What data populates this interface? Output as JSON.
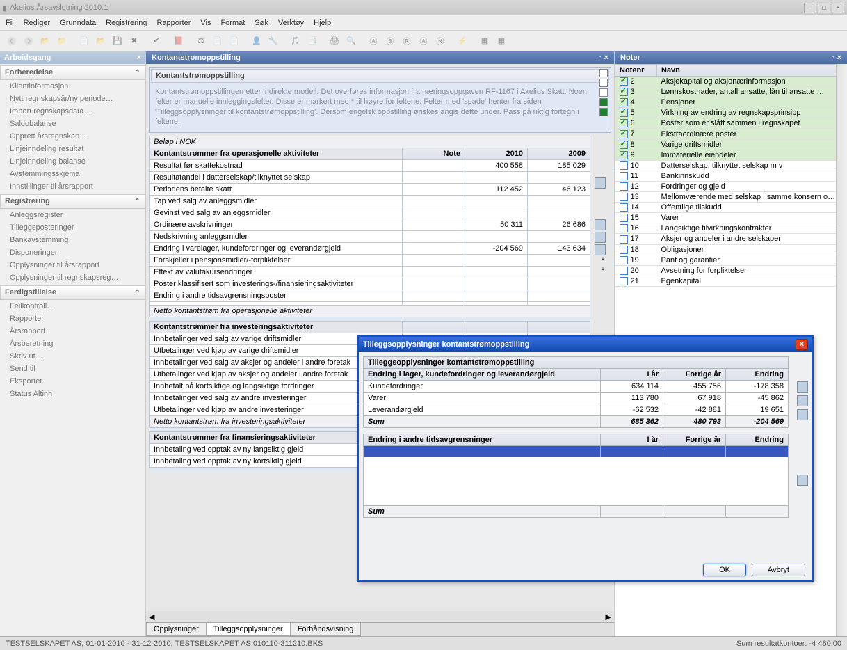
{
  "window": {
    "title": "Akelius Årsavslutning 2010.1"
  },
  "menu": [
    "Fil",
    "Rediger",
    "Grunndata",
    "Registrering",
    "Rapporter",
    "Vis",
    "Format",
    "Søk",
    "Verktøy",
    "Hjelp"
  ],
  "sidebar": {
    "title": "Arbeidsgang",
    "sections": [
      {
        "title": "Forberedelse",
        "items": [
          "Klientinformasjon",
          "Nytt regnskapsår/ny periode…",
          "Import regnskapsdata…",
          "Saldobalanse",
          "Opprett årsregnskap…",
          "Linjeinndeling resultat",
          "Linjeinndeling balanse",
          "Avstemmingsskjema",
          "Innstillinger til årsrapport"
        ]
      },
      {
        "title": "Registrering",
        "items": [
          "Anleggsregister",
          "Tilleggsposteringer",
          "Bankavstemming",
          "Disponeringer",
          "Opplysninger til årsrapport",
          "Opplysninger til regnskapsreg…"
        ]
      },
      {
        "title": "Ferdigstillelse",
        "items": [
          "Feilkontroll…",
          "Rapporter",
          "Årsrapport",
          "Årsberetning",
          "Skriv ut…",
          "Send til",
          "Eksporter",
          "Status Altinn"
        ]
      }
    ]
  },
  "center": {
    "title": "Kontantstrømoppstilling",
    "box_title": "Kontantstrømoppstilling",
    "desc": "Kontantstrømoppstillingen etter indirekte modell. Det overføres informasjon fra næringsoppgaven RF-1167 i Akelius Skatt. Noen felter er manuelle innleggingsfelter.  Disse er markert med * til høyre for feltene. Felter med 'spade' henter fra siden 'Tilleggsopplysninger til kontantstrømoppstilling'. Dersom engelsk oppstilling ønskes angis dette under. Pass på riktig fortegn i feltene.",
    "currency": "Beløp i NOK",
    "headers": {
      "note": "Note",
      "y1": "2010",
      "y2": "2009"
    },
    "sections": [
      {
        "title": "Kontantstrømmer fra operasjonelle aktiviteter",
        "rows": [
          {
            "l": "Resultat før skattekostnad",
            "a": "400 558",
            "b": "185 029"
          },
          {
            "l": "Resultatandel i datterselskap/tilknyttet selskap",
            "a": "",
            "b": ""
          },
          {
            "l": "Periodens betalte skatt",
            "a": "112 452",
            "b": "46 123"
          },
          {
            "l": "Tap ved salg av anleggsmidler",
            "a": "",
            "b": ""
          },
          {
            "l": "Gevinst ved salg av anleggsmidler",
            "a": "",
            "b": ""
          },
          {
            "l": "Ordinære avskrivninger",
            "a": "50 311",
            "b": "26 686"
          },
          {
            "l": "Nedskrivning anleggsmidler",
            "a": "",
            "b": ""
          },
          {
            "l": "Endring i varelager, kundefordringer og leverandørgjeld",
            "a": "-204 569",
            "b": "143 634"
          },
          {
            "l": "Forskjeller i pensjonsmidler/-forpliktelser",
            "a": "",
            "b": ""
          },
          {
            "l": "Effekt av valutakursendringer",
            "a": "",
            "b": ""
          },
          {
            "l": "Poster klassifisert som investerings-/finansieringsaktiviteter",
            "a": "",
            "b": ""
          },
          {
            "l": "Endring i andre tidsavgrensningsposter",
            "a": "",
            "b": ""
          },
          {
            "l": "",
            "a": "",
            "b": ""
          }
        ],
        "sum": "Netto kontantstrøm fra operasjonelle aktiviteter"
      },
      {
        "title": "Kontantstrømmer fra investeringsaktiviteter",
        "rows": [
          {
            "l": "Innbetalinger ved salg av varige driftsmidler",
            "a": "",
            "b": ""
          },
          {
            "l": "Utbetalinger ved kjøp av varige driftsmidler",
            "a": "",
            "b": ""
          },
          {
            "l": "Innbetalinger ved salg av aksjer og andeler i andre foretak",
            "a": "",
            "b": ""
          },
          {
            "l": "Utbetalinger ved kjøp av aksjer og andeler i andre foretak",
            "a": "",
            "b": ""
          },
          {
            "l": "Innbetalt på kortsiktige og langsiktige fordringer",
            "a": "",
            "b": ""
          },
          {
            "l": "Innbetalinger ved salg av andre investeringer",
            "a": "",
            "b": ""
          },
          {
            "l": "Utbetalinger ved kjøp av andre investeringer",
            "a": "",
            "b": ""
          }
        ],
        "sum": "Netto kontantstrøm fra investeringsaktiviteter"
      },
      {
        "title": "Kontantstrømmer fra finansieringsaktiviteter",
        "rows": [
          {
            "l": "Innbetaling ved opptak av ny langsiktig gjeld",
            "a": "",
            "b": ""
          },
          {
            "l": "Innbetaling ved opptak av ny kortsiktig gjeld",
            "a": "",
            "b": ""
          }
        ],
        "sum": ""
      }
    ],
    "tabs": [
      "Opplysninger",
      "Tilleggsopplysninger",
      "Forhåndsvisning"
    ],
    "active_tab": 1
  },
  "noter": {
    "title": "Noter",
    "headers": {
      "nr": "Notenr",
      "navn": "Navn"
    },
    "rows": [
      {
        "nr": "2",
        "navn": "Aksjekapital og aksjonærinformasjon",
        "on": true
      },
      {
        "nr": "3",
        "navn": "Lønnskostnader, antall ansatte, lån til ansatte …",
        "on": true
      },
      {
        "nr": "4",
        "navn": "Pensjoner",
        "on": true
      },
      {
        "nr": "5",
        "navn": "Virkning av endring av regnskapsprinsipp",
        "on": true
      },
      {
        "nr": "6",
        "navn": "Poster som er slått sammen i regnskapet",
        "on": true
      },
      {
        "nr": "7",
        "navn": "Ekstraordinære poster",
        "on": true
      },
      {
        "nr": "8",
        "navn": "Varige driftsmidler",
        "on": true
      },
      {
        "nr": "9",
        "navn": "Immaterielle eiendeler",
        "on": true
      },
      {
        "nr": "10",
        "navn": "Datterselskap, tilknyttet selskap m v",
        "on": false
      },
      {
        "nr": "11",
        "navn": "Bankinnskudd",
        "on": false
      },
      {
        "nr": "12",
        "navn": "Fordringer og gjeld",
        "on": false
      },
      {
        "nr": "13",
        "navn": "Mellomværende med selskap i samme konsern o…",
        "on": false
      },
      {
        "nr": "14",
        "navn": "Offentlige tilskudd",
        "on": false
      },
      {
        "nr": "15",
        "navn": "Varer",
        "on": false
      },
      {
        "nr": "16",
        "navn": "Langsiktige tilvirkningskontrakter",
        "on": false
      },
      {
        "nr": "17",
        "navn": "Aksjer og andeler i andre selskaper",
        "on": false
      },
      {
        "nr": "18",
        "navn": "Obligasjoner",
        "on": false
      },
      {
        "nr": "19",
        "navn": "Pant og garantier",
        "on": false
      },
      {
        "nr": "20",
        "navn": "Avsetning for forpliktelser",
        "on": false
      },
      {
        "nr": "21",
        "navn": "Egenkapital",
        "on": false
      }
    ]
  },
  "dialog": {
    "title": "Tilleggsopplysninger kontantstrømoppstilling",
    "tbl1_title": "Tilleggsopplysninger kontantstrømoppstilling",
    "h": {
      "l": "Endring i lager, kundefordringer og leverandørgjeld",
      "a": "I år",
      "b": "Forrige år",
      "c": "Endring"
    },
    "rows": [
      {
        "l": "Kundefordringer",
        "a": "634 114",
        "b": "455 756",
        "c": "-178 358"
      },
      {
        "l": "Varer",
        "a": "113 780",
        "b": "67 918",
        "c": "-45 862"
      },
      {
        "l": "Leverandørgjeld",
        "a": "-62 532",
        "b": "-42 881",
        "c": "19 651"
      }
    ],
    "sum": {
      "l": "Sum",
      "a": "685 362",
      "b": "480 793",
      "c": "-204 569"
    },
    "h2": {
      "l": "Endring i andre tidsavgrensninger",
      "a": "I år",
      "b": "Forrige år",
      "c": "Endring"
    },
    "sum2": "Sum",
    "ok": "OK",
    "cancel": "Avbryt"
  },
  "status": {
    "left": "TESTSELSKAPET AS, 01-01-2010 - 31-12-2010, TESTSELSKAPET AS 010110-311210.BKS",
    "right": "Sum resultatkontoer: -4 480,00"
  }
}
